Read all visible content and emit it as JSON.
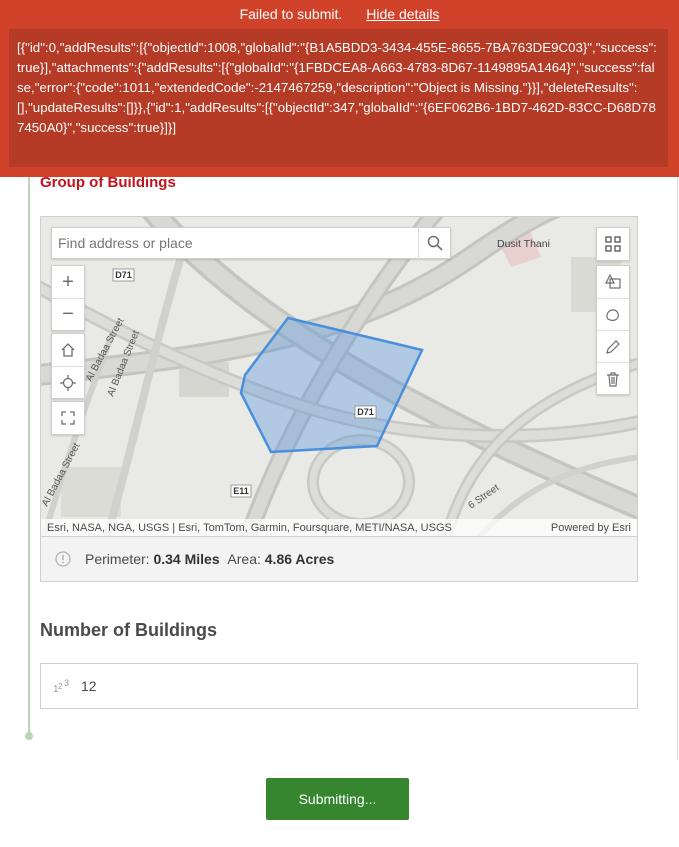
{
  "banner": {
    "message": "Failed to submit.",
    "toggle_label": "Hide details",
    "details": "[{\"id\":0,\"addResults\":[{\"objectId\":1008,\"globalId\":\"{B1A5BDD3-3434-455E-8655-7BA763DE9C03}\",\"success\":true}],\"attachments\":{\"addResults\":[{\"globalId\":\"{1FBDCEA8-A663-4783-8D67-1149895A1464}\",\"success\":false,\"error\":{\"code\":1011,\"extendedCode\":-2147467259,\"description\":\"Object is Missing.\"}}],\"deleteResults\":[],\"updateResults\":[]}},{\"id\":1,\"addResults\":[{\"objectId\":347,\"globalId\":\"{6EF062B6-1BD7-462D-83CC-D68D787450A0}\",\"success\":true}]}]"
  },
  "question1": {
    "label": "Group of Buildings"
  },
  "map": {
    "search_placeholder": "Find address or place",
    "zoom_in": "+",
    "zoom_out": "−",
    "attribution": "Esri, NASA, NGA, USGS | Esri, TomTom, Garmin, Foursquare, METI/NASA, USGS",
    "powered_by": "Powered by Esri",
    "labels": {
      "poi": "Dusit Thani",
      "road_d71_a": "D71",
      "road_d71_b": "D71",
      "road_e11": "E11",
      "street_1": "Al Badaa Street",
      "street_2": "Al Badaa Street",
      "street_3": "Al Badaa Street",
      "street_4": "6 Street"
    },
    "polygon_color": "#4a8fdc"
  },
  "measure": {
    "perimeter_label": "Perimeter:",
    "perimeter_value": "0.34 Miles",
    "area_label": "Area:",
    "area_value": "4.86 Acres"
  },
  "question2": {
    "label": "Number of Buildings",
    "value": "12"
  },
  "submit": {
    "label": "Submitting..."
  },
  "colors": {
    "banner": "#d0432a",
    "required_label": "#c0131b",
    "submit": "#35862f"
  }
}
